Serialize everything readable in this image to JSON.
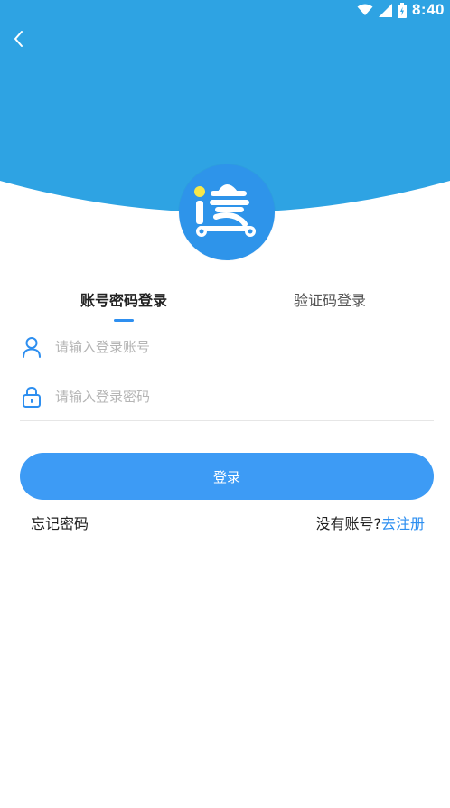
{
  "status_bar": {
    "time": "8:40",
    "icons": [
      "wifi-icon",
      "signal-icon",
      "battery-icon"
    ]
  },
  "colors": {
    "header_blue": "#2ea3e3",
    "accent_blue": "#2e8ff0",
    "button_blue": "#3d9bf5",
    "logo_blue": "#2e94ea",
    "logo_yellow": "#f7e84a"
  },
  "back_icon": "chevron-left-icon",
  "logo_icon": "app-logo-icon",
  "tabs": [
    {
      "label": "账号密码登录",
      "active": true
    },
    {
      "label": "验证码登录",
      "active": false
    }
  ],
  "form": {
    "account": {
      "placeholder": "请输入登录账号",
      "value": "",
      "icon": "user-icon"
    },
    "password": {
      "placeholder": "请输入登录密码",
      "value": "",
      "icon": "lock-icon"
    },
    "login_label": "登录"
  },
  "links": {
    "forgot": "忘记密码",
    "no_account": "没有账号?",
    "register": "去注册"
  }
}
